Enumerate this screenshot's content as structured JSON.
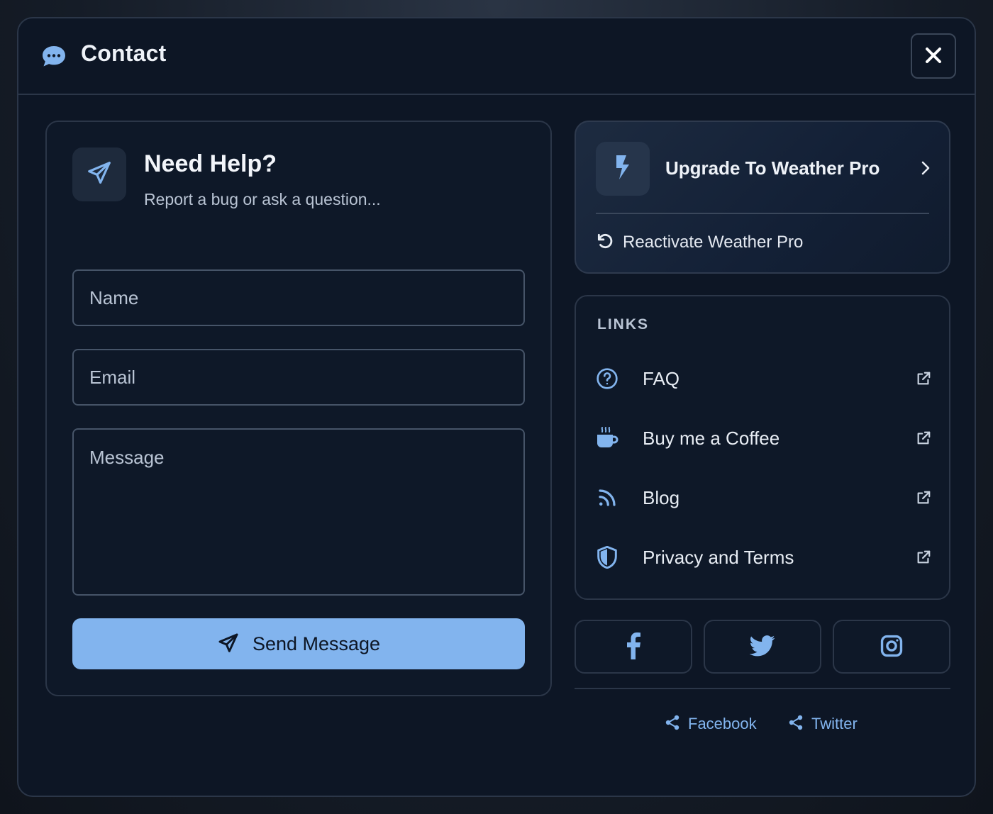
{
  "modal": {
    "title": "Contact",
    "close_icon": "close-icon"
  },
  "help": {
    "title": "Need Help?",
    "subtitle": "Report a bug or ask a question...",
    "name_placeholder": "Name",
    "email_placeholder": "Email",
    "message_placeholder": "Message",
    "send_label": "Send Message"
  },
  "pro": {
    "upgrade_label": "Upgrade To Weather Pro",
    "reactivate_label": "Reactivate Weather Pro"
  },
  "links": {
    "heading": "LINKS",
    "items": [
      {
        "label": "FAQ",
        "icon": "question-circle-icon"
      },
      {
        "label": "Buy me a Coffee",
        "icon": "coffee-icon"
      },
      {
        "label": "Blog",
        "icon": "rss-icon"
      },
      {
        "label": "Privacy and Terms",
        "icon": "shield-icon"
      }
    ]
  },
  "social": {
    "buttons": [
      "facebook-icon",
      "twitter-icon",
      "instagram-icon"
    ],
    "share": [
      {
        "label": "Facebook",
        "icon": "share-icon"
      },
      {
        "label": "Twitter",
        "icon": "share-icon"
      }
    ]
  },
  "colors": {
    "accent": "#82b4ee",
    "modal_bg": "#0d1625",
    "border": "#2b3648"
  }
}
